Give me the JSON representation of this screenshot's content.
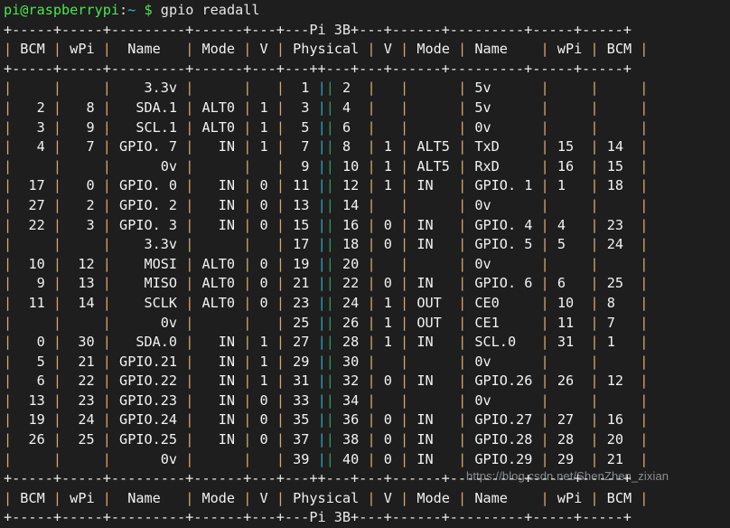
{
  "terminal": {
    "title": "gpio readall terminal output",
    "background_color": "#1e1e1e",
    "foreground_color": "#d8d8d8",
    "prompt": {
      "user_host": "pi@raspberrypi",
      "separator": ":",
      "path": "~",
      "sigil": "$",
      "command": "gpio readall",
      "user_host_color": "#4ee44e",
      "path_color": "#35b5d6",
      "sigil_color": "#4ee44e",
      "command_color": "#e6e6e6"
    },
    "watermark": "https://blog.csdn.net/ShenZhen_zixian"
  },
  "table": {
    "board_label": "Pi 3B",
    "rule": "+-----+-----+---------+------+---+---Pi 3B+---+------+---------+-----+-----+",
    "rule_plain": "+-----+-----+---------+------+---+---++---+---+------+---------+-----+-----+",
    "rule_bottom": "+-----+-----+---------+------+---+---++---+---+------+---------+-----+-----+",
    "rule_footer": "+-----+-----+---------+------+---+---Pi 3B+---+------+---------+-----+-----+",
    "headers_left": [
      "BCM",
      "wPi",
      "Name",
      "Mode",
      "V",
      "Physical"
    ],
    "headers_right": [
      "V",
      "Mode",
      "Name",
      "wPi",
      "BCM"
    ],
    "header_row_text": "| BCM | wPi |   Name  | Mode | V | Physical | V | Mode | Name    | wPi | BCM |",
    "columns": {
      "bcm_l": "BCM",
      "wpi_l": "wPi",
      "name_l": "Name",
      "mode_l": "Mode",
      "v_l": "V",
      "physical": "Physical",
      "v_r": "V",
      "mode_r": "Mode",
      "name_r": "Name",
      "wpi_r": "wPi",
      "bcm_r": "BCM"
    },
    "rows": [
      {
        "bcm_l": "",
        "wpi_l": "",
        "name_l": "3.3v",
        "mode_l": "",
        "v_l": "",
        "phys_l": "1",
        "phys_r": "2",
        "v_r": "",
        "mode_r": "",
        "name_r": "5v",
        "wpi_r": "",
        "bcm_r": ""
      },
      {
        "bcm_l": "2",
        "wpi_l": "8",
        "name_l": "SDA.1",
        "mode_l": "ALT0",
        "v_l": "1",
        "phys_l": "3",
        "phys_r": "4",
        "v_r": "",
        "mode_r": "",
        "name_r": "5v",
        "wpi_r": "",
        "bcm_r": ""
      },
      {
        "bcm_l": "3",
        "wpi_l": "9",
        "name_l": "SCL.1",
        "mode_l": "ALT0",
        "v_l": "1",
        "phys_l": "5",
        "phys_r": "6",
        "v_r": "",
        "mode_r": "",
        "name_r": "0v",
        "wpi_r": "",
        "bcm_r": ""
      },
      {
        "bcm_l": "4",
        "wpi_l": "7",
        "name_l": "GPIO. 7",
        "mode_l": "IN",
        "v_l": "1",
        "phys_l": "7",
        "phys_r": "8",
        "v_r": "1",
        "mode_r": "ALT5",
        "name_r": "TxD",
        "wpi_r": "15",
        "bcm_r": "14"
      },
      {
        "bcm_l": "",
        "wpi_l": "",
        "name_l": "0v",
        "mode_l": "",
        "v_l": "",
        "phys_l": "9",
        "phys_r": "10",
        "v_r": "1",
        "mode_r": "ALT5",
        "name_r": "RxD",
        "wpi_r": "16",
        "bcm_r": "15"
      },
      {
        "bcm_l": "17",
        "wpi_l": "0",
        "name_l": "GPIO. 0",
        "mode_l": "IN",
        "v_l": "0",
        "phys_l": "11",
        "phys_r": "12",
        "v_r": "1",
        "mode_r": "IN",
        "name_r": "GPIO. 1",
        "wpi_r": "1",
        "bcm_r": "18"
      },
      {
        "bcm_l": "27",
        "wpi_l": "2",
        "name_l": "GPIO. 2",
        "mode_l": "IN",
        "v_l": "0",
        "phys_l": "13",
        "phys_r": "14",
        "v_r": "",
        "mode_r": "",
        "name_r": "0v",
        "wpi_r": "",
        "bcm_r": ""
      },
      {
        "bcm_l": "22",
        "wpi_l": "3",
        "name_l": "GPIO. 3",
        "mode_l": "IN",
        "v_l": "0",
        "phys_l": "15",
        "phys_r": "16",
        "v_r": "0",
        "mode_r": "IN",
        "name_r": "GPIO. 4",
        "wpi_r": "4",
        "bcm_r": "23"
      },
      {
        "bcm_l": "",
        "wpi_l": "",
        "name_l": "3.3v",
        "mode_l": "",
        "v_l": "",
        "phys_l": "17",
        "phys_r": "18",
        "v_r": "0",
        "mode_r": "IN",
        "name_r": "GPIO. 5",
        "wpi_r": "5",
        "bcm_r": "24"
      },
      {
        "bcm_l": "10",
        "wpi_l": "12",
        "name_l": "MOSI",
        "mode_l": "ALT0",
        "v_l": "0",
        "phys_l": "19",
        "phys_r": "20",
        "v_r": "",
        "mode_r": "",
        "name_r": "0v",
        "wpi_r": "",
        "bcm_r": ""
      },
      {
        "bcm_l": "9",
        "wpi_l": "13",
        "name_l": "MISO",
        "mode_l": "ALT0",
        "v_l": "0",
        "phys_l": "21",
        "phys_r": "22",
        "v_r": "0",
        "mode_r": "IN",
        "name_r": "GPIO. 6",
        "wpi_r": "6",
        "bcm_r": "25"
      },
      {
        "bcm_l": "11",
        "wpi_l": "14",
        "name_l": "SCLK",
        "mode_l": "ALT0",
        "v_l": "0",
        "phys_l": "23",
        "phys_r": "24",
        "v_r": "1",
        "mode_r": "OUT",
        "name_r": "CE0",
        "wpi_r": "10",
        "bcm_r": "8"
      },
      {
        "bcm_l": "",
        "wpi_l": "",
        "name_l": "0v",
        "mode_l": "",
        "v_l": "",
        "phys_l": "25",
        "phys_r": "26",
        "v_r": "1",
        "mode_r": "OUT",
        "name_r": "CE1",
        "wpi_r": "11",
        "bcm_r": "7"
      },
      {
        "bcm_l": "0",
        "wpi_l": "30",
        "name_l": "SDA.0",
        "mode_l": "IN",
        "v_l": "1",
        "phys_l": "27",
        "phys_r": "28",
        "v_r": "1",
        "mode_r": "IN",
        "name_r": "SCL.0",
        "wpi_r": "31",
        "bcm_r": "1"
      },
      {
        "bcm_l": "5",
        "wpi_l": "21",
        "name_l": "GPIO.21",
        "mode_l": "IN",
        "v_l": "1",
        "phys_l": "29",
        "phys_r": "30",
        "v_r": "",
        "mode_r": "",
        "name_r": "0v",
        "wpi_r": "",
        "bcm_r": ""
      },
      {
        "bcm_l": "6",
        "wpi_l": "22",
        "name_l": "GPIO.22",
        "mode_l": "IN",
        "v_l": "1",
        "phys_l": "31",
        "phys_r": "32",
        "v_r": "0",
        "mode_r": "IN",
        "name_r": "GPIO.26",
        "wpi_r": "26",
        "bcm_r": "12"
      },
      {
        "bcm_l": "13",
        "wpi_l": "23",
        "name_l": "GPIO.23",
        "mode_l": "IN",
        "v_l": "0",
        "phys_l": "33",
        "phys_r": "34",
        "v_r": "",
        "mode_r": "",
        "name_r": "0v",
        "wpi_r": "",
        "bcm_r": ""
      },
      {
        "bcm_l": "19",
        "wpi_l": "24",
        "name_l": "GPIO.24",
        "mode_l": "IN",
        "v_l": "0",
        "phys_l": "35",
        "phys_r": "36",
        "v_r": "0",
        "mode_r": "IN",
        "name_r": "GPIO.27",
        "wpi_r": "27",
        "bcm_r": "16"
      },
      {
        "bcm_l": "26",
        "wpi_l": "25",
        "name_l": "GPIO.25",
        "mode_l": "IN",
        "v_l": "0",
        "phys_l": "37",
        "phys_r": "38",
        "v_r": "0",
        "mode_r": "IN",
        "name_r": "GPIO.28",
        "wpi_r": "28",
        "bcm_r": "20"
      },
      {
        "bcm_l": "",
        "wpi_l": "",
        "name_l": "0v",
        "mode_l": "",
        "v_l": "",
        "phys_l": "39",
        "phys_r": "40",
        "v_r": "0",
        "mode_r": "IN",
        "name_r": "GPIO.29",
        "wpi_r": "29",
        "bcm_r": "21"
      }
    ]
  }
}
